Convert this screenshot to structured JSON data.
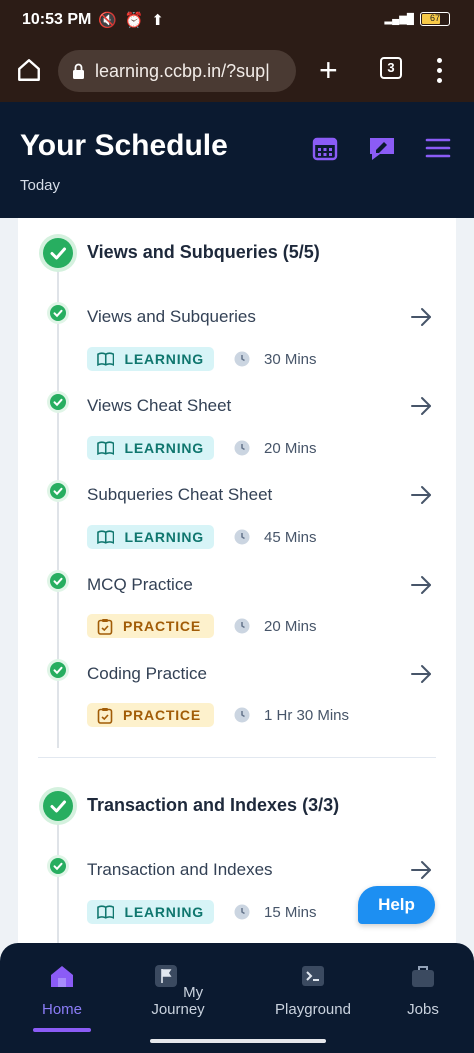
{
  "status_bar": {
    "time": "10:53 PM",
    "battery": "67"
  },
  "browser": {
    "url": "learning.ccbp.in/?sup|",
    "tab_count": "3"
  },
  "header": {
    "title": "Your Schedule",
    "subtitle": "Today"
  },
  "sections": [
    {
      "title": "Views and Subqueries (5/5)",
      "items": [
        {
          "title": "Views and Subqueries",
          "tag": "LEARNING",
          "duration": "30 Mins"
        },
        {
          "title": "Views Cheat Sheet",
          "tag": "LEARNING",
          "duration": "20 Mins"
        },
        {
          "title": "Subqueries Cheat Sheet",
          "tag": "LEARNING",
          "duration": "45 Mins"
        },
        {
          "title": "MCQ Practice",
          "tag": "PRACTICE",
          "duration": "20 Mins"
        },
        {
          "title": "Coding Practice",
          "tag": "PRACTICE",
          "duration": "1 Hr 30 Mins"
        }
      ]
    },
    {
      "title": "Transaction and Indexes (3/3)",
      "items": [
        {
          "title": "Transaction and Indexes",
          "tag": "LEARNING",
          "duration": "15 Mins"
        }
      ]
    }
  ],
  "help_button": "Help",
  "bottom_nav": [
    {
      "label": "Home",
      "icon": "home-icon",
      "active": true
    },
    {
      "label": "My Journey",
      "icon": "flag-icon",
      "active": false
    },
    {
      "label": "Playground",
      "icon": "terminal-icon",
      "active": false
    },
    {
      "label": "Jobs",
      "icon": "briefcase-icon",
      "active": false
    }
  ],
  "colors": {
    "header_bg": "#0b1a30",
    "accent_purple": "#8b5cf6",
    "success_green": "#27ae60",
    "help_blue": "#1d8ff2"
  }
}
